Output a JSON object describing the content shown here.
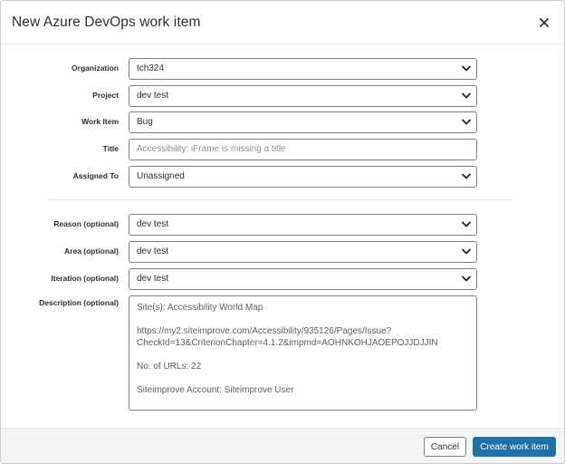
{
  "dialog": {
    "title": "New Azure DevOps work item",
    "close_icon": "close-icon"
  },
  "fields": {
    "organization": {
      "label": "Organization",
      "value": "tch324"
    },
    "project": {
      "label": "Project",
      "value": "dev test"
    },
    "work_item": {
      "label": "Work Item",
      "value": "Bug"
    },
    "title": {
      "label": "Title",
      "placeholder": "Accessibility: iFrame is missing a title"
    },
    "assigned_to": {
      "label": "Assigned To",
      "value": "Unassigned"
    },
    "reason": {
      "label": "Reason (optional)",
      "value": "dev test"
    },
    "area": {
      "label": "Area (optional)",
      "value": "dev test"
    },
    "iteration": {
      "label": "Iteration (optional)",
      "value": "dev test"
    },
    "description": {
      "label": "Description (optional)",
      "lines": [
        "Site(s): Accessibility World Map",
        "https://my2.siteimprove.com/Accessibility/935126/Pages/Issue?",
        "CheckId=13&CriterionChapter=4.1.2&impmd=AOHNKOHJAOEPOJJDJJIN",
        "No. of URLs: 22",
        "Siteimprove Account: Siteimprove User"
      ]
    }
  },
  "footer": {
    "cancel_label": "Cancel",
    "create_label": "Create work item"
  },
  "colors": {
    "primary": "#1f6fa8",
    "border": "#7b8089",
    "footer_bg": "#f4f5f6"
  },
  "icons": {
    "dropdown": "chevron-down-icon"
  }
}
